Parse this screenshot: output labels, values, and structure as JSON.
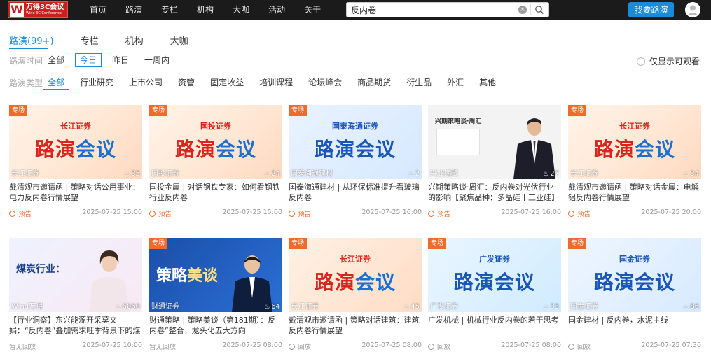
{
  "topbar": {
    "logo_main": "万得3C会议",
    "logo_sub": "Wind 3C Conference",
    "nav": [
      "首页",
      "路演",
      "专栏",
      "机构",
      "大咖",
      "活动",
      "关于"
    ],
    "search_value": "反内卷",
    "cta_label": "我要路演"
  },
  "page": {
    "tabs": [
      "路演(99+)",
      "专栏",
      "机构",
      "大咖"
    ],
    "time_label": "路演时间",
    "time_options": [
      "全部",
      "今日",
      "昨日",
      "一周内"
    ],
    "type_label": "路演类型",
    "type_options": [
      "全部",
      "行业研究",
      "上市公司",
      "资管",
      "固定收益",
      "培训课程",
      "论坛峰会",
      "商品期货",
      "衍生品",
      "外汇",
      "其他"
    ],
    "only_label": "仅显示可观看"
  },
  "cards": [
    {
      "badge": "专场",
      "source": "长江证券",
      "views": "35",
      "title": "戴清观市邀请函 | 策略对话公用事业：电力反内卷行情展望",
      "status": "预告",
      "time": "2025-07-25 15:00",
      "brand": "长江证券",
      "big1": "路演",
      "big2": "会议"
    },
    {
      "badge": "专场",
      "source": "国投证券",
      "views": "24",
      "title": "国投金属 | 对话钢铁专家：如何看钢铁行业反内卷",
      "status": "预告",
      "time": "2025-07-25 15:00",
      "brand": "国投证券",
      "big1": "路演",
      "big2": "会议"
    },
    {
      "badge": "专场",
      "source": "国泰海通建材",
      "views": "2",
      "title": "国泰海通建材 | 从环保标准提升看玻璃反内卷",
      "status": "预告",
      "time": "2025-07-25 16:00",
      "brand": "国泰海通证券",
      "big1": "路演",
      "big2": "会议"
    },
    {
      "badge": "",
      "source": "兴业期货",
      "views": "27",
      "title": "兴期策略谈·周汇：反内卷对光伏行业的影响【聚焦品种：多晶硅丨工业硅】",
      "status": "预告",
      "time": "2025-07-25 16:00",
      "brand": "兴期策略谈·周汇",
      "big1": "",
      "big2": ""
    },
    {
      "badge": "专场",
      "source": "长江证券",
      "views": "34",
      "title": "戴清观市邀请函 | 策略对话金属：电解铝反内卷行情展望",
      "status": "预告",
      "time": "2025-07-25 20:00",
      "brand": "长江证券",
      "big1": "路演",
      "big2": "会议"
    },
    {
      "badge": "",
      "source": "Wind万得",
      "views": "6060",
      "title": "【行业洞察】东兴能源开采莫文娟：“反内卷”叠加需求旺季背景下的煤炭...",
      "status": "暂无回放",
      "time": "2025-07-25 10:00",
      "brand": "煤炭行业：",
      "big1": "",
      "big2": ""
    },
    {
      "badge": "专场",
      "source": "财通证券",
      "views": "64",
      "title": "财通策略 | 策略美谈（第181期）：反内卷”整合，龙头化五大方向",
      "status": "暂无回放",
      "time": "2025-07-25 08:00",
      "brand": "财通证券",
      "big1": "策略",
      "big2": "美谈"
    },
    {
      "badge": "专场",
      "source": "长江证券",
      "views": "45",
      "title": "戴清观市邀请函 | 策略对话建筑：建筑反内卷行情展望",
      "status": "回放",
      "time": "2025-07-25 08:00",
      "brand": "长江证券",
      "big1": "路演",
      "big2": "会议"
    },
    {
      "badge": "专场",
      "source": "广发证券",
      "views": "33",
      "title": "广发机械 | 机械行业反内卷的若干思考",
      "status": "回放",
      "time": "2025-07-25 08:00",
      "brand": "广发证券",
      "big1": "路演",
      "big2": "会议"
    },
    {
      "badge": "专场",
      "source": "国金证券",
      "views": "86",
      "title": "国金建材 | 反内卷，水泥主线",
      "status": "回放",
      "time": "2025-07-25 07:30",
      "brand": "国金证券",
      "big1": "路演",
      "big2": "会议"
    }
  ]
}
